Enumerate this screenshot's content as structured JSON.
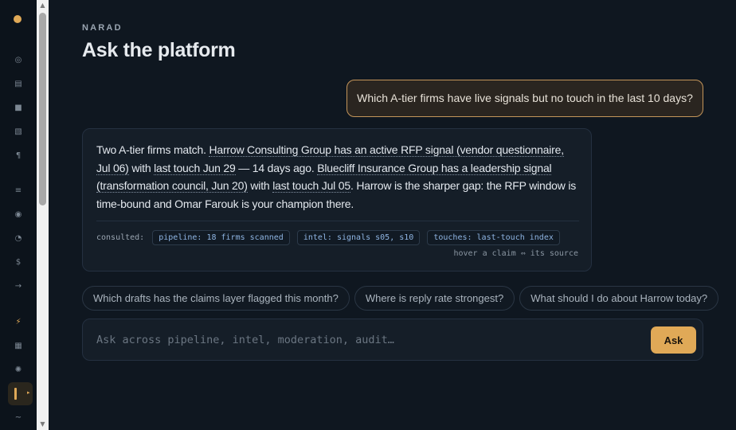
{
  "app": {
    "eyebrow": "NARAD",
    "title": "Ask the platform"
  },
  "rail": {
    "items": [
      {
        "icon": "target-icon",
        "glyph": "◎"
      },
      {
        "icon": "table-icon",
        "glyph": "▤"
      },
      {
        "icon": "square-icon",
        "glyph": "■"
      },
      {
        "icon": "image-icon",
        "glyph": "▧"
      },
      {
        "icon": "pilcrow-icon",
        "glyph": "¶"
      },
      {
        "icon": "list-icon",
        "glyph": "≡"
      },
      {
        "icon": "radio-icon",
        "glyph": "◉"
      },
      {
        "icon": "pie-icon",
        "glyph": "◔"
      },
      {
        "icon": "dollar-icon",
        "glyph": "$"
      },
      {
        "icon": "arrow-right-icon",
        "glyph": "→"
      },
      {
        "icon": "bolt-icon",
        "glyph": "⚡"
      },
      {
        "icon": "grid-icon",
        "glyph": "▦"
      },
      {
        "icon": "sun-icon",
        "glyph": "✺"
      },
      {
        "icon": "wave-icon",
        "glyph": "~"
      }
    ],
    "active_arrow": "▸"
  },
  "conversation": {
    "user_message": "Which A-tier firms have live signals but no touch in the last 10 days?",
    "answer": {
      "p1": "Two A-tier firms match. ",
      "c1": "Harrow Consulting Group has an active RFP signal (vendor questionnaire, Jul 06)",
      "p2": " with ",
      "c2": "last touch Jun 29",
      "p3": " — 14 days ago. ",
      "c3": "Bluecliff Insurance Group has a leadership signal (transformation council, Jun 20)",
      "p4": " with ",
      "c4": "last touch Jul 05",
      "p5": ". Harrow is the sharper gap: the RFP window is time-bound and Omar Farouk is your champion there."
    },
    "consulted_label": "consulted:",
    "sources": [
      "pipeline: 18 firms scanned",
      "intel: signals s05, s10",
      "touches: last-touch index"
    ],
    "hover_hint": "hover a claim ⇔ its source"
  },
  "suggestions": [
    "Which drafts has the claims layer flagged this month?",
    "Where is reply rate strongest?",
    "What should I do about Harrow today?"
  ],
  "ask": {
    "placeholder": "Ask across pipeline, intel, moderation, audit…",
    "value": "",
    "button_label": "Ask"
  },
  "scrollbar": {
    "up": "▲",
    "down": "▼"
  },
  "colors": {
    "accent": "#e0a957",
    "background": "#0f1720",
    "card": "#151e28",
    "chip_text": "#8fb5e3"
  }
}
